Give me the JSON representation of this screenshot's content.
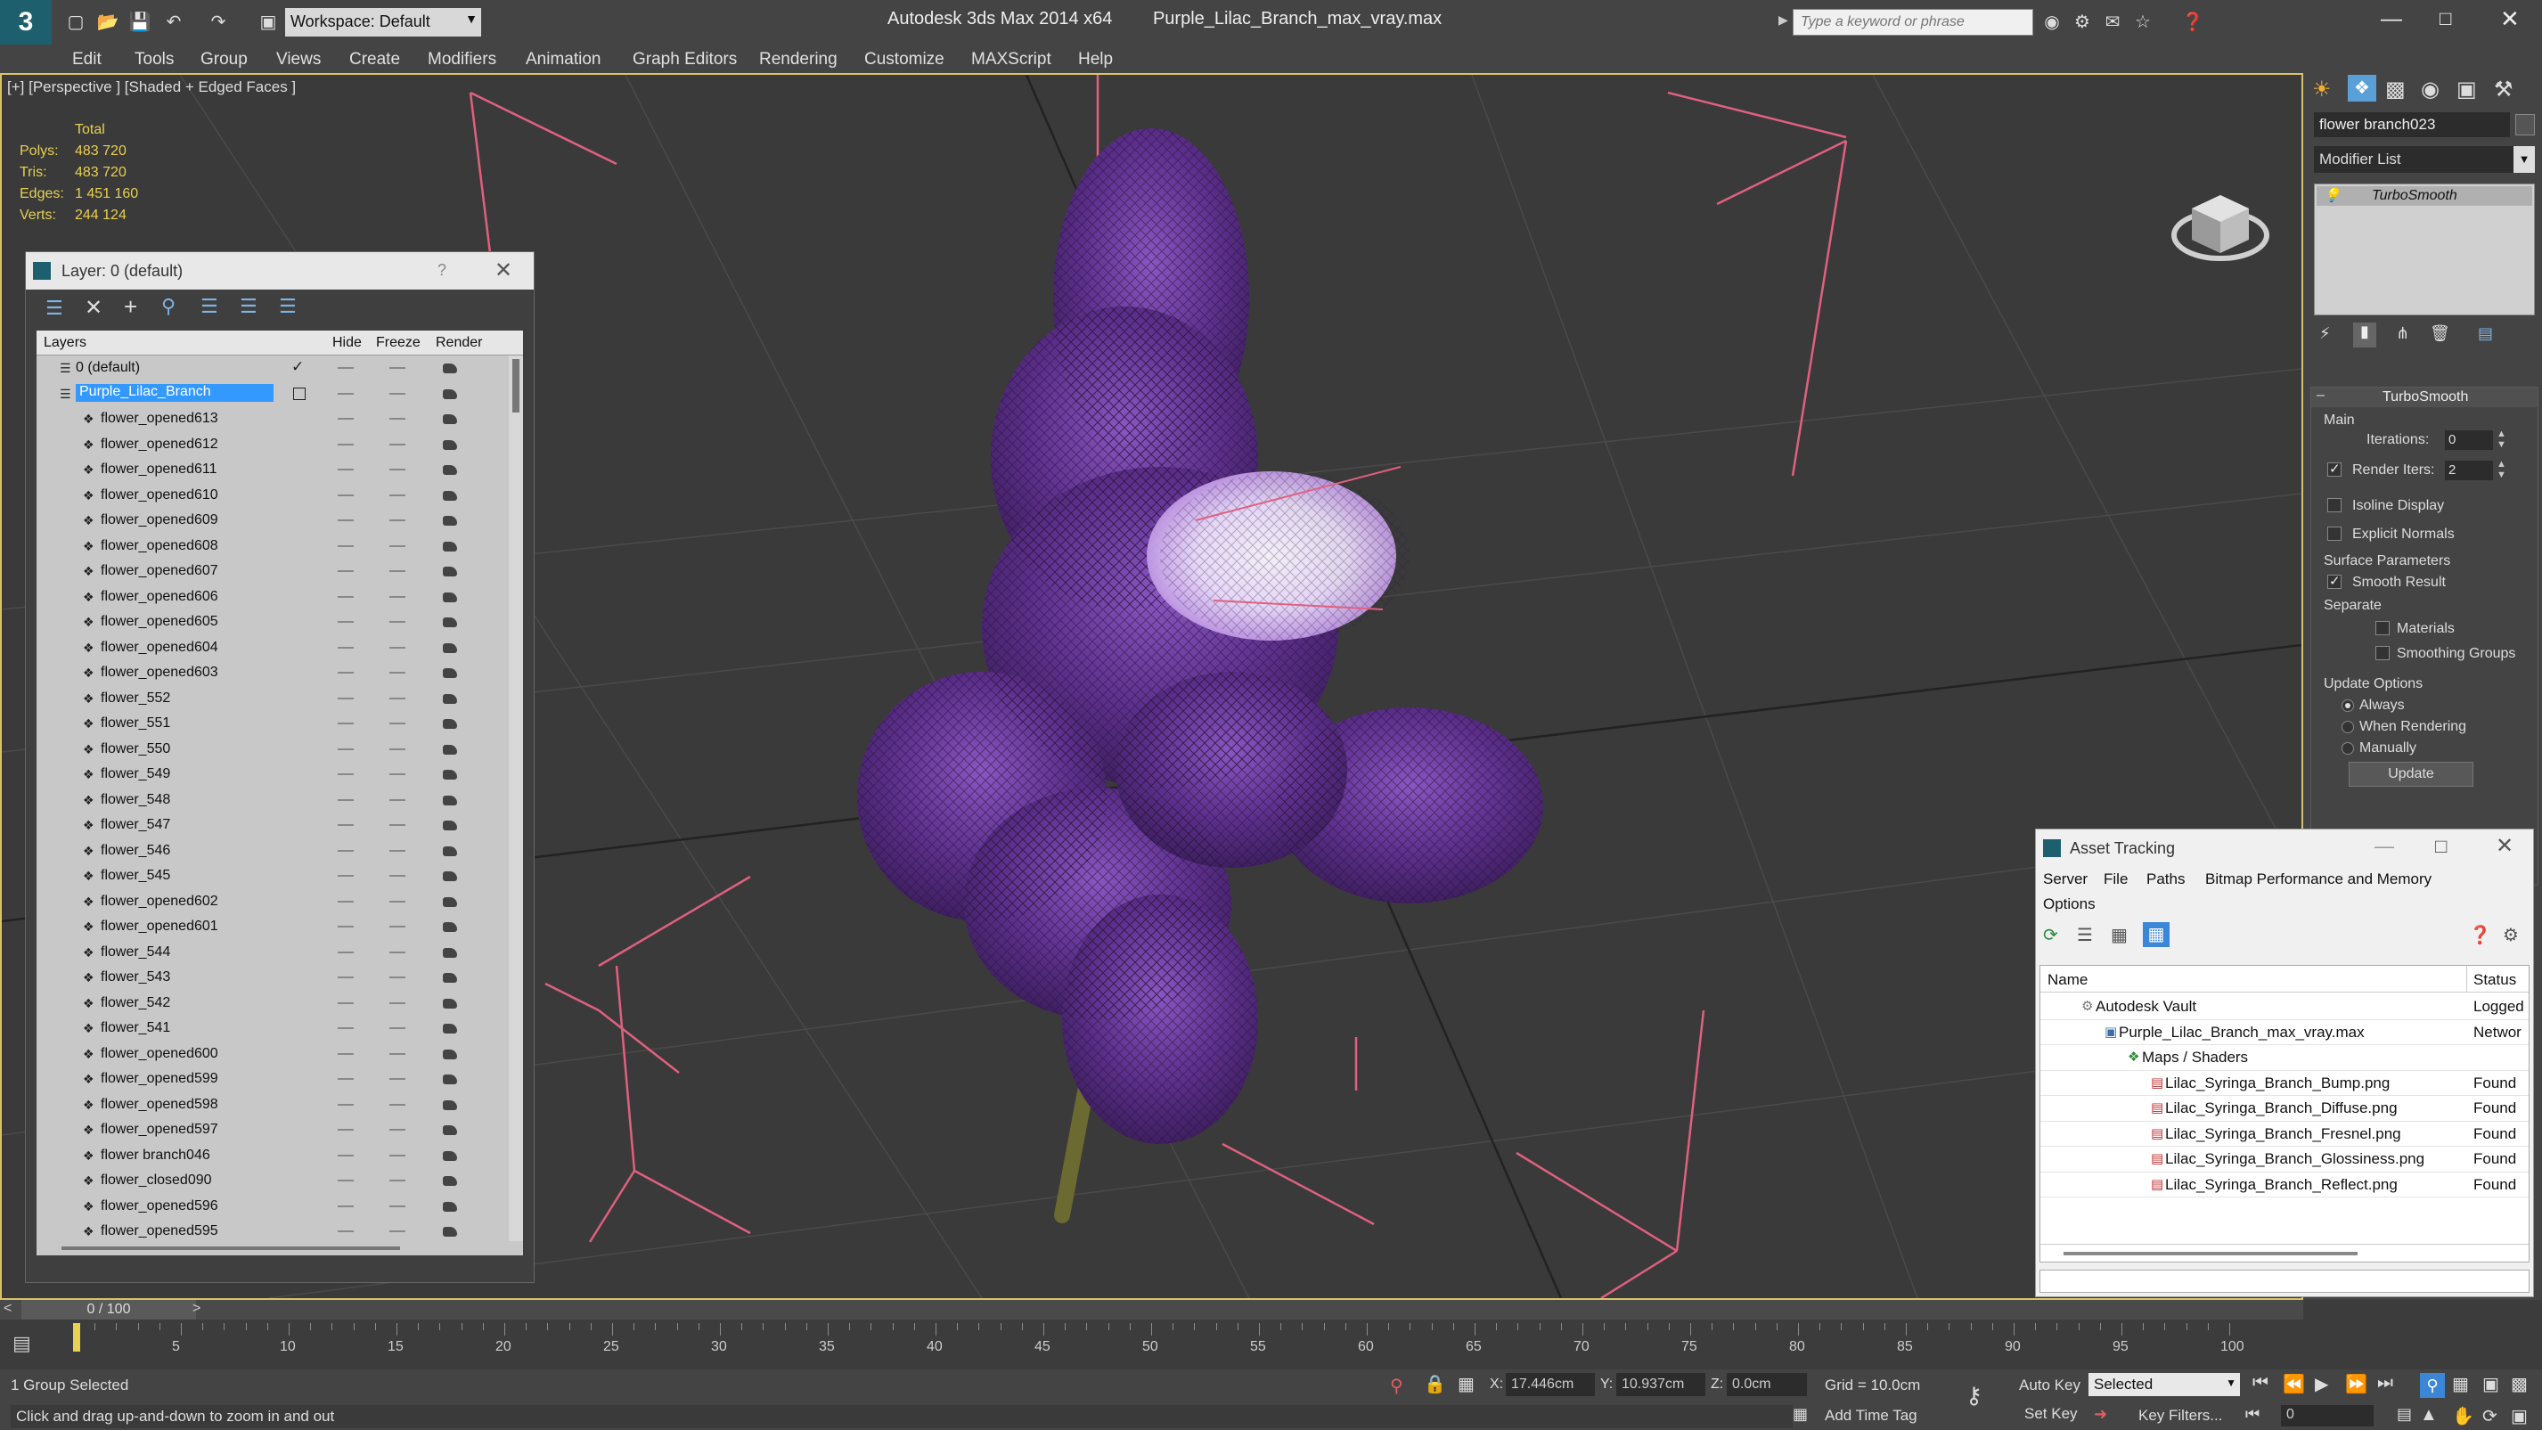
{
  "app": {
    "title": "Autodesk 3ds Max  2014 x64",
    "file": "Purple_Lilac_Branch_max_vray.max",
    "workspace": "Workspace: Default",
    "search_placeholder": "Type a keyword or phrase"
  },
  "menu": [
    "Edit",
    "Tools",
    "Group",
    "Views",
    "Create",
    "Modifiers",
    "Animation",
    "Graph Editors",
    "Rendering",
    "Customize",
    "MAXScript",
    "Help"
  ],
  "viewport": {
    "label": "[+] [Perspective ] [Shaded + Edged Faces ]",
    "stats": {
      "header": "Total",
      "rows": [
        {
          "label": "Polys:",
          "value": "483 720"
        },
        {
          "label": "Tris:",
          "value": "483 720"
        },
        {
          "label": "Edges:",
          "value": "1 451 160"
        },
        {
          "label": "Verts:",
          "value": "244 124"
        }
      ]
    }
  },
  "layer_window": {
    "title": "Layer: 0 (default)",
    "help": "?",
    "columns": [
      "Layers",
      "Hide",
      "Freeze",
      "Render"
    ],
    "default_layer": "0 (default)",
    "selected_layer": "Purple_Lilac_Branch",
    "items": [
      "flower_opened613",
      "flower_opened612",
      "flower_opened611",
      "flower_opened610",
      "flower_opened609",
      "flower_opened608",
      "flower_opened607",
      "flower_opened606",
      "flower_opened605",
      "flower_opened604",
      "flower_opened603",
      "flower_552",
      "flower_551",
      "flower_550",
      "flower_549",
      "flower_548",
      "flower_547",
      "flower_546",
      "flower_545",
      "flower_opened602",
      "flower_opened601",
      "flower_544",
      "flower_543",
      "flower_542",
      "flower_541",
      "flower_opened600",
      "flower_opened599",
      "flower_opened598",
      "flower_opened597",
      "flower branch046",
      "flower_closed090",
      "flower_opened596",
      "flower_opened595"
    ]
  },
  "command_panel": {
    "object_name": "flower branch023",
    "modifier_list": "Modifier List",
    "stack_item": "TurboSmooth",
    "rollout_title": "TurboSmooth",
    "main_label": "Main",
    "iterations_label": "Iterations:",
    "iterations_value": "0",
    "render_iters_label": "Render Iters:",
    "render_iters_value": "2",
    "isoline_label": "Isoline Display",
    "explicit_normals_label": "Explicit Normals",
    "surface_params_label": "Surface Parameters",
    "smooth_result_label": "Smooth Result",
    "separate_label": "Separate",
    "materials_label": "Materials",
    "smoothing_groups_label": "Smoothing Groups",
    "update_options_label": "Update Options",
    "always_label": "Always",
    "when_rendering_label": "When Rendering",
    "manually_label": "Manually",
    "update_button": "Update"
  },
  "asset_tracking": {
    "title": "Asset Tracking",
    "menu": [
      "Server",
      "File",
      "Paths",
      "Bitmap Performance and Memory"
    ],
    "options": "Options",
    "columns": [
      "Name",
      "Status"
    ],
    "rows": [
      {
        "name": "Autodesk Vault",
        "status": "Logged",
        "indent": 0
      },
      {
        "name": "Purple_Lilac_Branch_max_vray.max",
        "status": "Networ",
        "indent": 1
      },
      {
        "name": "Maps / Shaders",
        "status": "",
        "indent": 2
      },
      {
        "name": "Lilac_Syringa_Branch_Bump.png",
        "status": "Found",
        "indent": 3
      },
      {
        "name": "Lilac_Syringa_Branch_Diffuse.png",
        "status": "Found",
        "indent": 3
      },
      {
        "name": "Lilac_Syringa_Branch_Fresnel.png",
        "status": "Found",
        "indent": 3
      },
      {
        "name": "Lilac_Syringa_Branch_Glossiness.png",
        "status": "Found",
        "indent": 3
      },
      {
        "name": "Lilac_Syringa_Branch_Reflect.png",
        "status": "Found",
        "indent": 3
      }
    ]
  },
  "timeline": {
    "frame": "0 / 100",
    "ticks": [
      "5",
      "10",
      "15",
      "20",
      "25",
      "30",
      "35",
      "40",
      "45",
      "50",
      "55",
      "60",
      "65",
      "70",
      "75",
      "80",
      "85",
      "90",
      "95",
      "100"
    ]
  },
  "status": {
    "selection": "1 Group Selected",
    "prompt": "Click and drag up-and-down to zoom in and out",
    "x_label": "X:",
    "x_value": "17.446cm",
    "y_label": "Y:",
    "y_value": "10.937cm",
    "z_label": "Z:",
    "z_value": "0.0cm",
    "grid": "Grid = 10.0cm",
    "add_time_tag": "Add Time Tag",
    "auto_key": "Auto Key",
    "set_key": "Set Key",
    "selected_dropdown": "Selected",
    "key_filters": "Key Filters...",
    "frame_field": "0"
  },
  "colors": {
    "ui_dark": "#444444",
    "viewport": "#3a3a3a",
    "selection": "#3399ff",
    "stats_value": "#e8d050",
    "flower": "#6b3a9a",
    "gizmo_lines": "#e06080"
  }
}
